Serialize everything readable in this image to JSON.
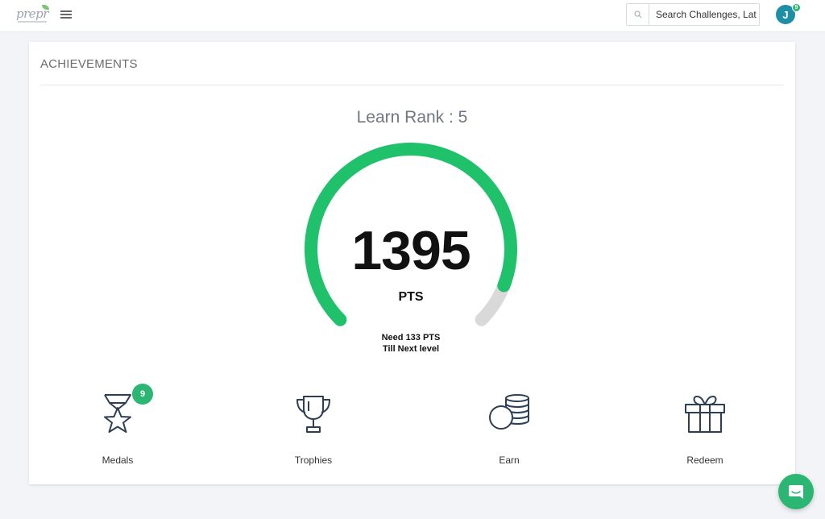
{
  "header": {
    "logo_text": "prepr",
    "search_placeholder": "Search Challenges, Lat",
    "avatar_initial": "J",
    "notification_count": "9"
  },
  "achievements": {
    "title": "ACHIEVEMENTS",
    "rank_label": "Learn Rank : 5",
    "points": "1395",
    "points_unit": "PTS",
    "need_line1": "Need 133 PTS",
    "need_line2": "Till Next level",
    "progress_fraction": 0.913
  },
  "items": [
    {
      "label": "Medals",
      "icon": "medal-icon",
      "badge": "9"
    },
    {
      "label": "Trophies",
      "icon": "trophy-icon"
    },
    {
      "label": "Earn",
      "icon": "coins-icon"
    },
    {
      "label": "Redeem",
      "icon": "gift-icon"
    }
  ],
  "colors": {
    "accent": "#1fc16b",
    "track": "#d9d9d9",
    "icon_stroke": "#2d3e55",
    "badge": "#2bb673"
  }
}
